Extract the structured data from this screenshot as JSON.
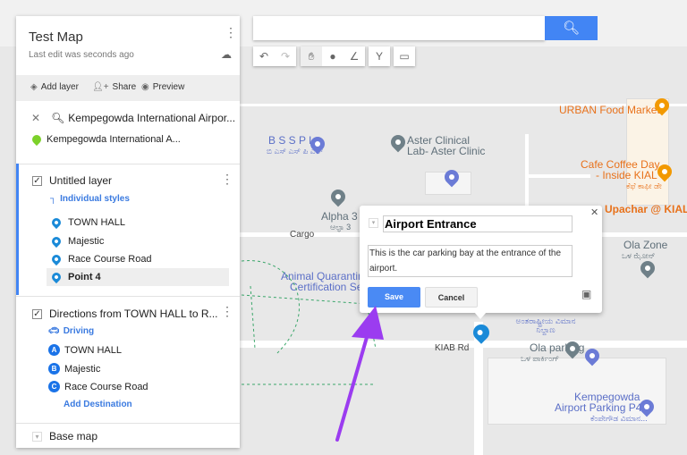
{
  "panel": {
    "title": "Test Map",
    "last_edit": "Last edit was seconds ago",
    "actions": {
      "add_layer": "Add layer",
      "share": "Share",
      "preview": "Preview"
    },
    "search_result": {
      "query": "Kempegowda International Airpor...",
      "place": "Kempegowda International A..."
    },
    "layer1": {
      "title": "Untitled layer",
      "style": "Individual styles",
      "items": [
        "TOWN HALL",
        "Majestic",
        "Race Course Road",
        "Point 4"
      ]
    },
    "layer2": {
      "title": "Directions from TOWN HALL to R...",
      "mode": "Driving",
      "stops": [
        {
          "letter": "A",
          "name": "TOWN HALL"
        },
        {
          "letter": "B",
          "name": "Majestic"
        },
        {
          "letter": "C",
          "name": "Race Course Road"
        }
      ],
      "add": "Add Destination"
    },
    "base_map": "Base map"
  },
  "search": {
    "value": "",
    "button_icon": "search-icon"
  },
  "popup": {
    "title": "Airport Entrance",
    "description": "This is the car parking bay at the entrance of the airport.",
    "save": "Save",
    "cancel": "Cancel"
  },
  "map_labels": {
    "urban": "URBAN Food Market",
    "bsspl": "B S S P L",
    "bsspl_kn": "ಬಿ ಎಸ್ ಎಸ್ ಪಿ ಎಲ್",
    "aster": "Aster Clinical",
    "aster2": "Lab- Aster Clinic",
    "ccd": "Cafe Coffee Day",
    "ccd2": "- Inside KIAL",
    "ccd_kn": "ಕೆಫೆ ಕಾಫೀ ಡೇ",
    "alpha": "Alpha 3",
    "alpha_kn": "ಆಲ್ಫಾ 3",
    "cargo": "Cargo",
    "upachar": "Upachar @ KIAL",
    "olazone": "Ola Zone",
    "olazone_kn": "ಒಳ ಝೋನ್",
    "animal": "Animal Quarantin",
    "animal2": "Certification Se",
    "airport_kn": "ಅಂತರಾಷ್ಟ್ರೀಯ ವಿಮಾನ ನಿಲ್ದಾಣ",
    "kiab": "KIAB Rd",
    "olaparking": "Ola parking",
    "olaparking_kn": "ಒಳ ಪಾರ್ಕಿಂಗ್",
    "p4": "Kempegowda",
    "p4b": "Airport Parking P4",
    "p4_kn": "ಕೆಂಪೇಗೌಡ ವಿಮಾನ..."
  },
  "colors": {
    "accent": "#4285f4",
    "pin": "#1a8ad8",
    "arrow": "#9b3cf0"
  }
}
